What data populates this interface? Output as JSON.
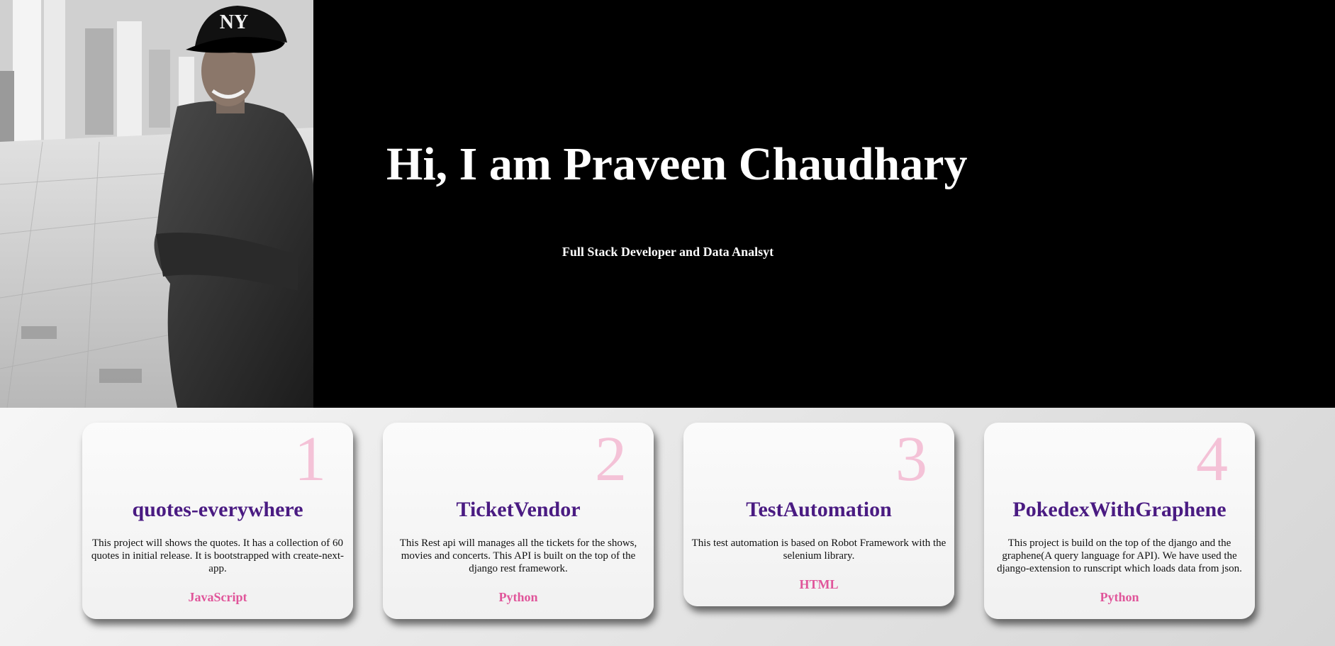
{
  "hero": {
    "title": "Hi, I am Praveen Chaudhary",
    "subtitle": "Full Stack Developer and Data Analsyt",
    "background_color": "#000000",
    "text_color": "#ffffff",
    "photo_icon": "profile-photo"
  },
  "projects": [
    {
      "number": "1",
      "title": "quotes-everywhere",
      "description": "This project will shows the quotes. It has a collection of 60 quotes in initial release. It is bootstrapped with create-next-app.",
      "language": "JavaScript"
    },
    {
      "number": "2",
      "title": "TicketVendor",
      "description": "This Rest api will manages all the tickets for the shows, movies and concerts. This API is built on the top of the django rest framework.",
      "language": "Python"
    },
    {
      "number": "3",
      "title": "TestAutomation",
      "description": "This test automation is based on Robot Framework with the selenium library.",
      "language": "HTML"
    },
    {
      "number": "4",
      "title": "PokedexWithGraphene",
      "description": "This project is build on the top of the django and the graphene(A query language for API). We have used the django-extension to runscript which loads data from json.",
      "language": "Python"
    }
  ],
  "colors": {
    "card_title": "#4a1b82",
    "card_number": "#f4c2d7",
    "card_language": "#e0559a"
  }
}
